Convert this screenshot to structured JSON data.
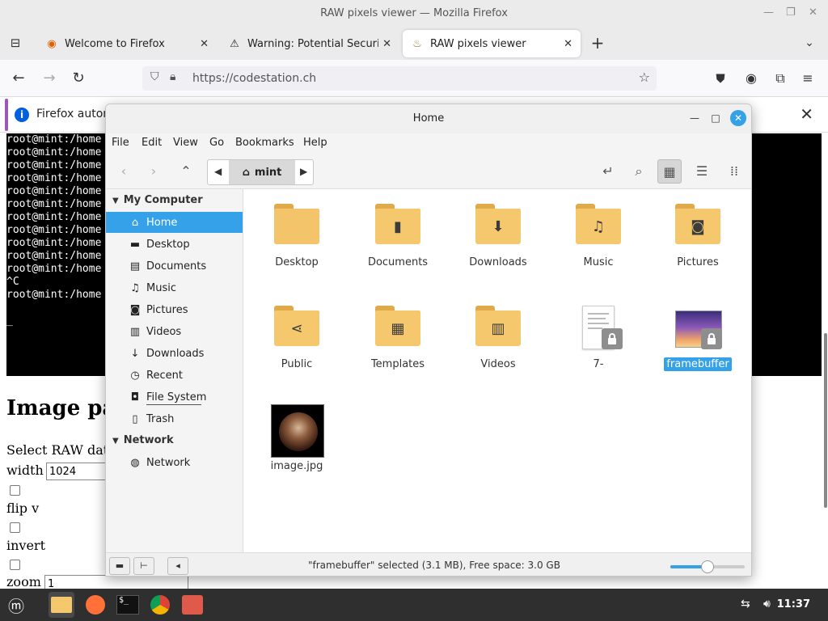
{
  "window": {
    "title": "RAW pixels viewer — Mozilla Firefox"
  },
  "tabs": [
    {
      "label": "Welcome to Firefox",
      "icon": "firefox-icon"
    },
    {
      "label": "Warning: Potential Security",
      "icon": "warning-icon"
    },
    {
      "label": "RAW pixels viewer",
      "icon": "raw-viewer-icon"
    }
  ],
  "navbar": {
    "url": "https://codestation.ch"
  },
  "notification": {
    "text": "Firefox autom"
  },
  "terminal": {
    "lines": [
      "root@mint:/home",
      "root@mint:/home",
      "root@mint:/home",
      "root@mint:/home",
      "root@mint:/home",
      "root@mint:/home",
      "root@mint:/home",
      "root@mint:/home",
      "root@mint:/home",
      "root@mint:/home",
      "root@mint:/home",
      "^C",
      "root@mint:/home",
      "",
      "_"
    ]
  },
  "page": {
    "heading": "Image par",
    "select_label": "Select RAW data",
    "width_label": "width",
    "width_value": "1024",
    "flip_label": "flip v",
    "invert_label": "invert",
    "zoom_label": "zoom",
    "zoom_value": "1"
  },
  "filemanager": {
    "title": "Home",
    "menu": [
      "File",
      "Edit",
      "View",
      "Go",
      "Bookmarks",
      "Help"
    ],
    "breadcrumb": "mint",
    "sidebar": {
      "section1": "My Computer",
      "items1": [
        {
          "label": "Home",
          "icon": "home-icon"
        },
        {
          "label": "Desktop",
          "icon": "desktop-icon"
        },
        {
          "label": "Documents",
          "icon": "documents-icon"
        },
        {
          "label": "Music",
          "icon": "music-icon"
        },
        {
          "label": "Pictures",
          "icon": "pictures-icon"
        },
        {
          "label": "Videos",
          "icon": "videos-icon"
        },
        {
          "label": "Downloads",
          "icon": "downloads-icon"
        },
        {
          "label": "Recent",
          "icon": "recent-icon"
        },
        {
          "label": "File System",
          "icon": "filesystem-icon"
        },
        {
          "label": "Trash",
          "icon": "trash-icon"
        }
      ],
      "section2": "Network",
      "items2": [
        {
          "label": "Network",
          "icon": "network-icon"
        }
      ]
    },
    "files": [
      {
        "name": "Desktop",
        "kind": "folder"
      },
      {
        "name": "Documents",
        "kind": "folder-documents"
      },
      {
        "name": "Downloads",
        "kind": "folder-downloads"
      },
      {
        "name": "Music",
        "kind": "folder-music"
      },
      {
        "name": "Pictures",
        "kind": "folder-pictures"
      },
      {
        "name": "Public",
        "kind": "folder-public"
      },
      {
        "name": "Templates",
        "kind": "folder-templates"
      },
      {
        "name": "Videos",
        "kind": "folder-videos"
      },
      {
        "name": "7-",
        "kind": "text-file-locked"
      },
      {
        "name": "framebuffer",
        "kind": "image-file-locked"
      },
      {
        "name": "image.jpg",
        "kind": "image-file"
      }
    ],
    "selected_file": "framebuffer",
    "status": "\"framebuffer\" selected (3.1 MB), Free space: 3.0 GB",
    "zoom_level": 0.5
  },
  "taskbar": {
    "apps": [
      "menu-icon",
      "files-icon",
      "firefox-icon",
      "terminal-icon",
      "chromium-icon",
      "image-viewer-icon"
    ],
    "clock": "11:37"
  },
  "colors": {
    "accent": "#35a1e8",
    "folder": "#f5c86e",
    "taskbar": "#2f2f2f"
  }
}
